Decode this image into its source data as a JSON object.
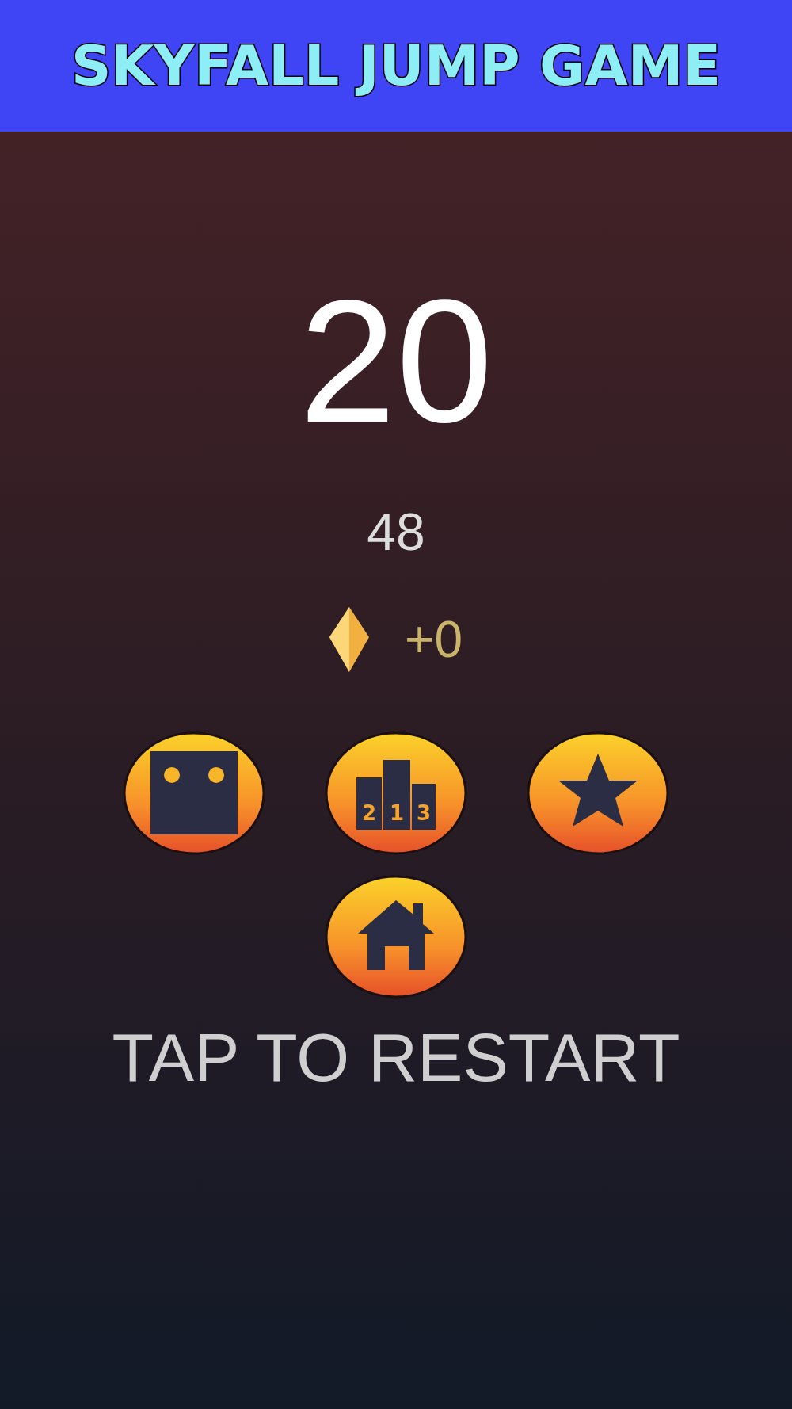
{
  "header": {
    "title": "SKYFALL JUMP GAME"
  },
  "score": "20",
  "best": "48",
  "gems": {
    "text": "+0"
  },
  "buttons": [
    {
      "kind": "character"
    },
    {
      "kind": "leaderboard",
      "labels": [
        "2",
        "1",
        "3"
      ]
    },
    {
      "kind": "rate"
    },
    {
      "kind": "home"
    }
  ],
  "prompt": "TAP TO RESTART"
}
